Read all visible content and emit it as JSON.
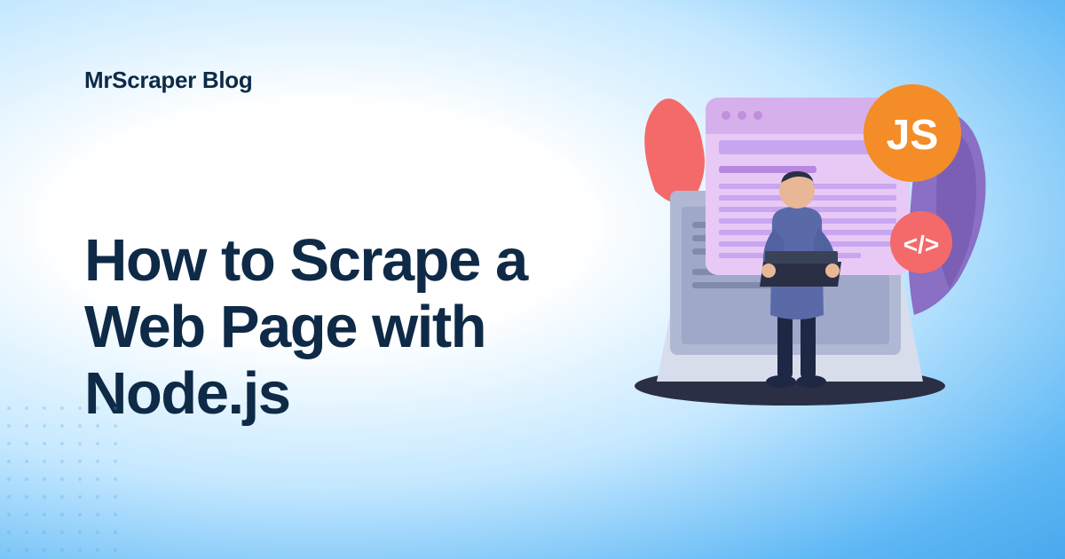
{
  "brand": "MrScraper Blog",
  "headline": "How to Scrape a Web Page with Node.js",
  "badges": {
    "js": "JS",
    "code": "</>"
  },
  "colors": {
    "text": "#0e2a47",
    "accentOrange": "#f48c28",
    "accentCoral": "#f46a6a",
    "accentPurple": "#c9a6f0",
    "accentLaptop": "#b0b8d4",
    "accentPerson": "#5a6aa8"
  }
}
